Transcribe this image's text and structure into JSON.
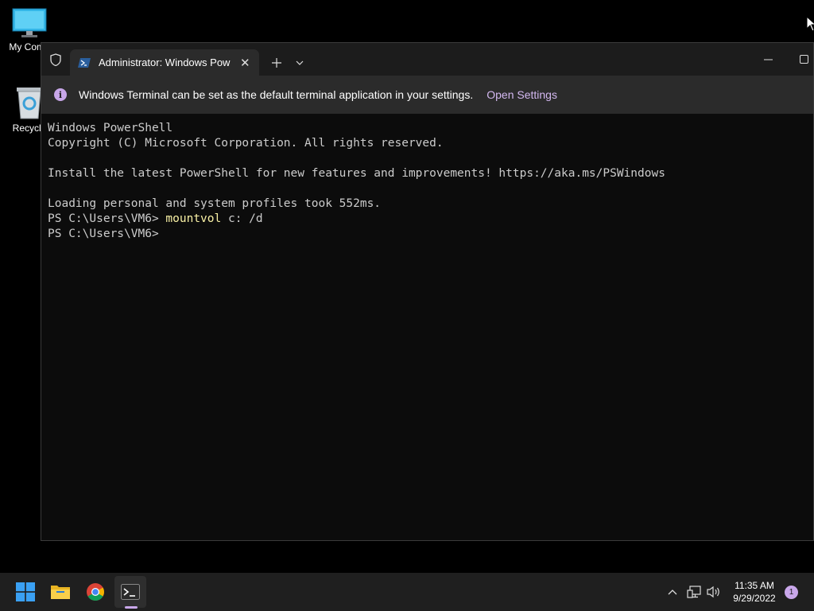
{
  "desktop": {
    "icons": [
      {
        "label": "My Comp",
        "icon": "computer-icon"
      },
      {
        "label": "Recycle",
        "icon": "recycle-bin-icon"
      }
    ]
  },
  "window": {
    "tab": {
      "title": "Administrator: Windows Powe",
      "icon": "powershell-icon"
    },
    "infobar": {
      "message": "Windows Terminal can be set as the default terminal application in your settings.",
      "link": "Open Settings"
    },
    "terminal": {
      "lines": [
        "Windows PowerShell",
        "Copyright (C) Microsoft Corporation. All rights reserved.",
        "",
        "Install the latest PowerShell for new features and improvements! https://aka.ms/PSWindows",
        "",
        "Loading personal and system profiles took 552ms."
      ],
      "prompt1": "PS C:\\Users\\VM6> ",
      "command1": "mountvol",
      "args1": " c: /d",
      "prompt2": "PS C:\\Users\\VM6> "
    }
  },
  "taskbar": {
    "apps": [
      "start-icon",
      "file-explorer-icon",
      "chrome-icon",
      "terminal-icon"
    ],
    "clock": {
      "time": "11:35 AM",
      "date": "9/29/2022"
    },
    "notification_count": "1"
  },
  "colors": {
    "accent": "#c9a7ea",
    "terminal_bg": "#0c0c0c",
    "command": "#f9f1a5"
  }
}
